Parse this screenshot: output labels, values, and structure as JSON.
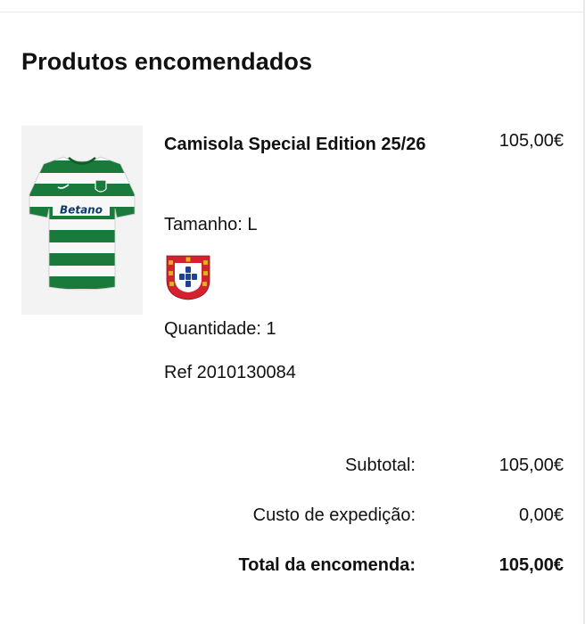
{
  "section": {
    "title": "Produtos encomendados"
  },
  "product": {
    "name": "Camisola Special Edition 25/26",
    "price": "105,00€",
    "size": "Tamanho: L",
    "quantity": "Quantidade: 1",
    "reference": "Ref 2010130084",
    "image": {
      "icon": "jersey-image",
      "sponsor_text": "Betano",
      "colors": {
        "stripe_green": "#1a7a3b",
        "stripe_white": "#f7f7f7",
        "background": "#f3f3f3"
      }
    },
    "badge": {
      "icon": "portugal-coat-of-arms-badge",
      "colors": {
        "shield_red": "#d4202f",
        "shield_white": "#ffffff",
        "quinas_blue": "#1f3f9a",
        "castle_gold": "#e6b21e"
      }
    }
  },
  "summary": {
    "subtotal_label": "Subtotal:",
    "subtotal_value": "105,00€",
    "shipping_label": "Custo de expedição:",
    "shipping_value": "0,00€",
    "total_label": "Total da encomenda:",
    "total_value": "105,00€"
  }
}
